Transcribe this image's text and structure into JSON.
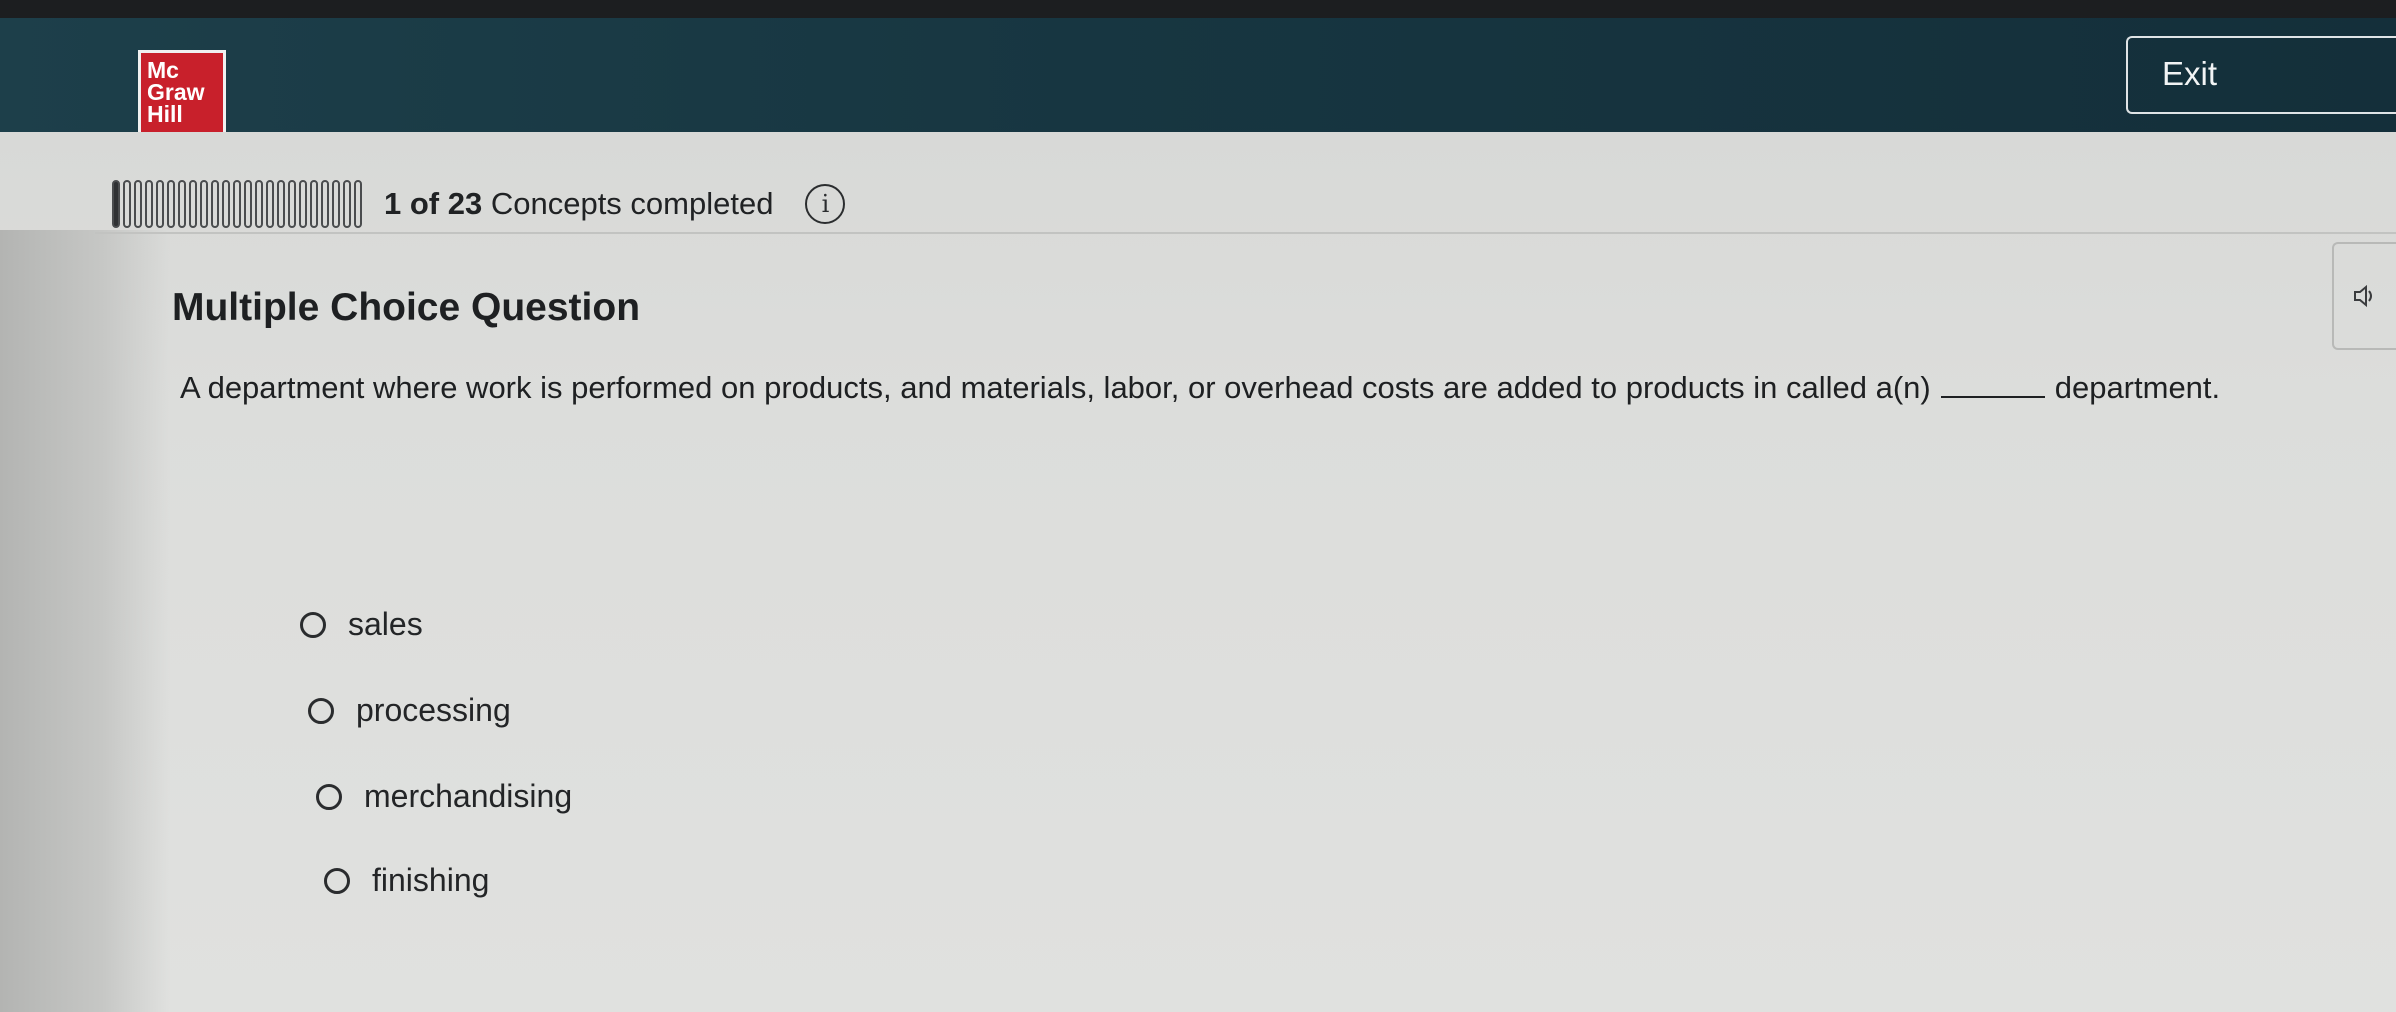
{
  "header": {
    "logo_lines": [
      "Mc",
      "Graw",
      "Hill"
    ],
    "exit_label": "Exit Assignment"
  },
  "progress": {
    "completed": 1,
    "total": 23,
    "count_text": "1 of 23",
    "suffix_text": "Concepts completed"
  },
  "question": {
    "type_label": "Multiple Choice Question",
    "text_before_blank": "A department where work is performed on products, and materials, labor, or overhead costs are added to products in called a(n)",
    "text_after_blank": "department.",
    "options": [
      {
        "label": "sales"
      },
      {
        "label": "processing"
      },
      {
        "label": "merchandising"
      },
      {
        "label": "finishing"
      }
    ]
  },
  "icons": {
    "info": "info-icon",
    "speaker": "speaker-icon"
  },
  "colors": {
    "header_bg": "#173641",
    "logo_red": "#c8202b",
    "content_bg": "#dcdddb"
  }
}
